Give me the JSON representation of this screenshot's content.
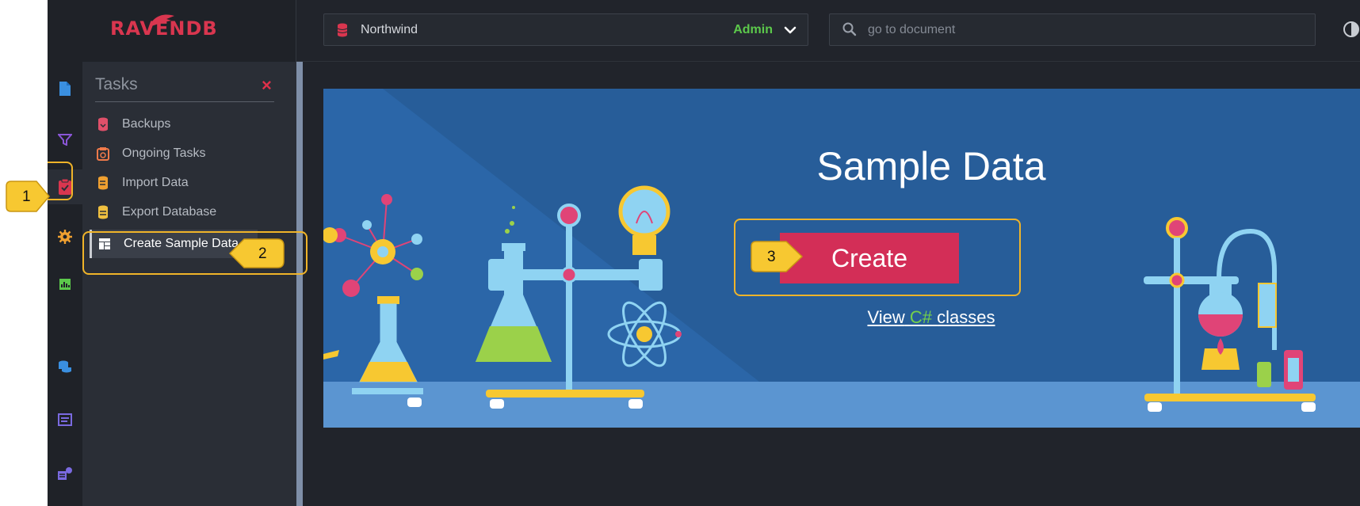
{
  "app": {
    "logo_text": "RAVENDB"
  },
  "header": {
    "database": "Northwind",
    "role": "Admin",
    "search_placeholder": "go to document"
  },
  "rail": {
    "icons": [
      "documents-icon",
      "indexes-icon",
      "tasks-icon",
      "settings-icon",
      "stats-icon",
      "databases-icon",
      "manage-server-icon",
      "cluster-icon"
    ],
    "active": "tasks-icon"
  },
  "tasks_panel": {
    "title": "Tasks",
    "close_label": "×",
    "items": [
      {
        "label": "Backups",
        "icon": "backup-icon"
      },
      {
        "label": "Ongoing Tasks",
        "icon": "ongoing-tasks-icon"
      },
      {
        "label": "Import Data",
        "icon": "import-icon"
      },
      {
        "label": "Export Database",
        "icon": "export-icon"
      },
      {
        "label": "Create Sample Data",
        "icon": "sample-data-icon",
        "active": true
      }
    ]
  },
  "main": {
    "title": "Sample Data",
    "create_label": "Create",
    "view_prefix": "View",
    "view_lang": "C#",
    "view_suffix": "classes"
  },
  "callouts": [
    {
      "number": "1",
      "target": "tasks-icon"
    },
    {
      "number": "2",
      "target": "Create Sample Data"
    },
    {
      "number": "3",
      "target": "Create"
    }
  ],
  "colors": {
    "brand": "#d9364f",
    "role": "#5cc94b",
    "create_button": "#d32e57",
    "banner": "#2c6cae",
    "callout": "#f7c831",
    "csharp": "#75d14a"
  }
}
